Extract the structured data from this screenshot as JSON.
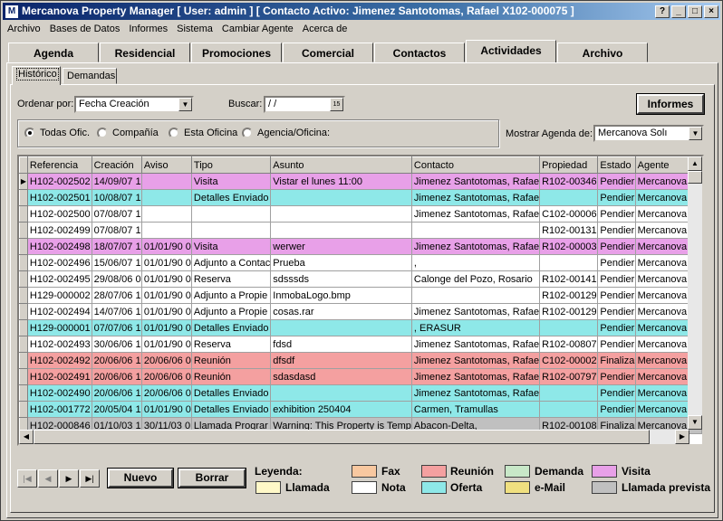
{
  "window": {
    "title": "Mercanova Property Manager [ User: admin ] [ Contacto Activo:  Jimenez Santotomas, Rafael   X102-000075 ]",
    "controls": [
      "?",
      "_",
      "□",
      "×"
    ]
  },
  "menu": [
    "Archivo",
    "Bases de Datos",
    "Informes",
    "Sistema",
    "Cambiar Agente",
    "Acerca de"
  ],
  "tabs": [
    "Agenda",
    "Residencial",
    "Promociones",
    "Comercial",
    "Contactos",
    "Actividades",
    "Archivo"
  ],
  "active_tab": "Actividades",
  "subtabs": [
    "Histórico",
    "Demandas"
  ],
  "filters": {
    "order_label": "Ordenar por:",
    "order_value": "Fecha Creación",
    "search_label": "Buscar:",
    "search_value": "/  /",
    "reports_button": "Informes",
    "radios": [
      "Todas Ofic.",
      "Compañía",
      "Esta Oficina",
      "Agencia/Oficina:"
    ],
    "selected_radio": "Todas Ofic.",
    "agenda_label": "Mostrar Agenda de:",
    "agenda_value": "Mercanova Solı"
  },
  "table": {
    "columns": [
      "Referencia",
      "Creación",
      "Aviso",
      "Tipo",
      "Asunto",
      "Contacto",
      "Propiedad",
      "Estado",
      "Agente"
    ],
    "rows": [
      {
        "c": [
          "H102-002502",
          "14/09/07 1",
          "",
          "Visita",
          "Vistar el lunes 11:00",
          "Jimenez Santotomas, Rafae",
          "R102-00346",
          "Pendier",
          "Mercanova Sc"
        ],
        "color": "#e8a0e8",
        "current": true
      },
      {
        "c": [
          "H102-002501",
          "10/08/07 1",
          "",
          "Detalles Enviado",
          "",
          "Jimenez Santotomas, Rafae",
          "",
          "Pendier",
          "Mercanova Sc"
        ],
        "color": "#8ee8e8"
      },
      {
        "c": [
          "H102-002500",
          "07/08/07 1",
          "",
          "",
          "",
          "Jimenez Santotomas, Rafae",
          "C102-00006",
          "Pendier",
          "Mercanova Sc"
        ],
        "color": "#ffffff"
      },
      {
        "c": [
          "H102-002499",
          "07/08/07 1",
          "",
          "",
          "",
          "",
          "R102-00131",
          "Pendier",
          "Mercanova Sc"
        ],
        "color": "#ffffff"
      },
      {
        "c": [
          "H102-002498",
          "18/07/07 1",
          "01/01/90 0",
          "Visita",
          "werwer",
          "Jimenez Santotomas, Rafae",
          "R102-00003",
          "Pendier",
          "Mercanova Sc"
        ],
        "color": "#e8a0e8"
      },
      {
        "c": [
          "H102-002496",
          "15/06/07 1",
          "01/01/90 0",
          "Adjunto a Contac",
          "Prueba",
          ",",
          "",
          "Pendier",
          "Mercanova Sc"
        ],
        "color": "#ffffff"
      },
      {
        "c": [
          "H102-002495",
          "29/08/06 0",
          "01/01/90 0",
          "Reserva",
          "sdsssds",
          "Calonge del Pozo, Rosario",
          "R102-00141",
          "Pendier",
          "Mercanova Sc"
        ],
        "color": "#ffffff"
      },
      {
        "c": [
          "H129-000002",
          "28/07/06 1",
          "01/01/90 0",
          "Adjunto a Propie",
          "InmobaLogo.bmp",
          "",
          "R102-00129",
          "Pendier",
          "Mercanova Sc"
        ],
        "color": "#ffffff"
      },
      {
        "c": [
          "H102-002494",
          "14/07/06 1",
          "01/01/90 0",
          "Adjunto a Propie",
          "cosas.rar",
          "Jimenez Santotomas, Rafae",
          "R102-00129",
          "Pendier",
          "Mercanova Sc"
        ],
        "color": "#ffffff"
      },
      {
        "c": [
          "H129-000001",
          "07/07/06 1",
          "01/01/90 0",
          "Detalles Enviado",
          "",
          ", ERASUR",
          "",
          "Pendier",
          "Mercanova Sc"
        ],
        "color": "#8ee8e8"
      },
      {
        "c": [
          "H102-002493",
          "30/06/06 1",
          "01/01/90 0",
          "Reserva",
          "fdsd",
          "Jimenez Santotomas, Rafae",
          "R102-00807",
          "Pendier",
          "Mercanova Sc"
        ],
        "color": "#ffffff"
      },
      {
        "c": [
          "H102-002492",
          "20/06/06 1",
          "20/06/06 0",
          "Reunión",
          "dfsdf",
          "Jimenez Santotomas, Rafae",
          "C102-00002",
          "Finaliza",
          "Mercanova Sc"
        ],
        "color": "#f4a0a0"
      },
      {
        "c": [
          "H102-002491",
          "20/06/06 1",
          "20/06/06 0",
          "Reunión",
          "sdasdasd",
          "Jimenez Santotomas, Rafae",
          "R102-00797",
          "Pendier",
          "Mercanova Sc"
        ],
        "color": "#f4a0a0"
      },
      {
        "c": [
          "H102-002490",
          "20/06/06 1",
          "20/06/06 0",
          "Detalles Enviado",
          "",
          "Jimenez Santotomas, Rafae",
          "",
          "Pendier",
          "Mercanova Sc"
        ],
        "color": "#8ee8e8"
      },
      {
        "c": [
          "H102-001772",
          "20/05/04 1",
          "01/01/90 0",
          "Detalles Enviado",
          "exhibition 250404",
          "Carmen, Tramullas",
          "",
          "Pendier",
          "Mercanova Sc"
        ],
        "color": "#8ee8e8"
      },
      {
        "c": [
          "H102-000846",
          "01/10/03 1",
          "30/11/03 0",
          "Llamada Prograr",
          "Warning: This Property is Temp",
          "Abacon-Delta,",
          "R102-00108",
          "Finaliza",
          "Mercanova Sc"
        ],
        "color": "#c0c0c0"
      }
    ]
  },
  "nav": {
    "first": "|◀",
    "prev": "◀",
    "next": "▶",
    "last": "▶|",
    "new_button": "Nuevo",
    "delete_button": "Borrar"
  },
  "legend": {
    "title": "Leyenda:",
    "items": [
      {
        "label": "Llamada",
        "color": "#fff8c8"
      },
      {
        "label": "Fax",
        "color": "#f8c8a0"
      },
      {
        "label": "Nota",
        "color": "#ffffff"
      },
      {
        "label": "Reunión",
        "color": "#f4a0a0"
      },
      {
        "label": "Oferta",
        "color": "#8ee8e8"
      },
      {
        "label": "Demanda",
        "color": "#c8e8c8"
      },
      {
        "label": "e-Mail",
        "color": "#f0e080"
      },
      {
        "label": "Visita",
        "color": "#e8a0e8"
      },
      {
        "label": "Llamada prevista",
        "color": "#c0c0c0"
      }
    ]
  }
}
